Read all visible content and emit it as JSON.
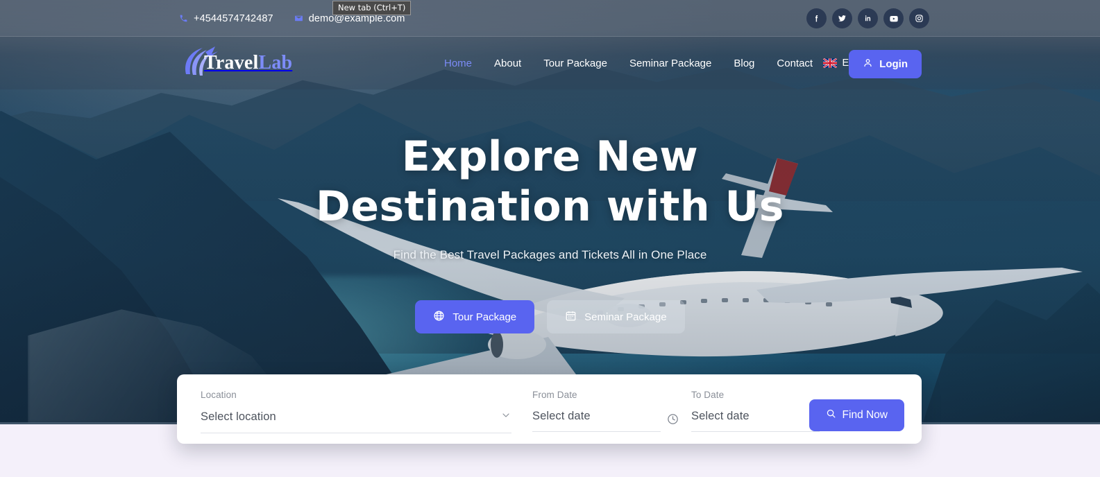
{
  "browser": {
    "tooltip": "New tab (Ctrl+T)"
  },
  "topbar": {
    "phone": "+4544574742487",
    "phone_icon": "phone-icon",
    "email": "demo@example.com",
    "email_icon": "envelope-icon",
    "socials": [
      {
        "name": "facebook",
        "glyph": "f"
      },
      {
        "name": "twitter",
        "glyph": "t"
      },
      {
        "name": "linkedin",
        "glyph": "in"
      },
      {
        "name": "youtube",
        "glyph": "yt"
      },
      {
        "name": "instagram",
        "glyph": "ig"
      }
    ]
  },
  "header": {
    "logo": {
      "primary": "Travel",
      "accent": "Lab",
      "icon": "plane-swoosh-icon"
    },
    "nav": [
      {
        "label": "Home",
        "active": true
      },
      {
        "label": "About",
        "active": false
      },
      {
        "label": "Tour Package",
        "active": false
      },
      {
        "label": "Seminar Package",
        "active": false
      },
      {
        "label": "Blog",
        "active": false
      },
      {
        "label": "Contact",
        "active": false
      }
    ],
    "language": {
      "label": "English",
      "flag": "uk-flag-icon",
      "chevron": "chevron-down-icon"
    },
    "login": {
      "label": "Login",
      "icon": "user-icon"
    }
  },
  "hero": {
    "title_line1": "Explore New",
    "title_line2": "Destination with Us",
    "subtitle": "Find the Best Travel Packages and Tickets All in One Place",
    "tabs": [
      {
        "label": "Tour Package",
        "icon": "globe-icon",
        "active": true
      },
      {
        "label": "Seminar Package",
        "icon": "calendar-icon",
        "active": false
      }
    ]
  },
  "search": {
    "location": {
      "label": "Location",
      "value": "Select location",
      "chevron": "chevron-down-icon"
    },
    "from_date": {
      "label": "From Date",
      "value": "Select date"
    },
    "to_date": {
      "label": "To Date",
      "value": "Select date",
      "icon": "clock-icon"
    },
    "submit": {
      "label": "Find Now",
      "icon": "search-icon"
    }
  },
  "colors": {
    "accent": "#5964f0",
    "nav_active": "#7b8bf7",
    "card_bg": "#ffffff",
    "page_bg": "#f4f0fa",
    "social_bg": "#2b3a54"
  }
}
